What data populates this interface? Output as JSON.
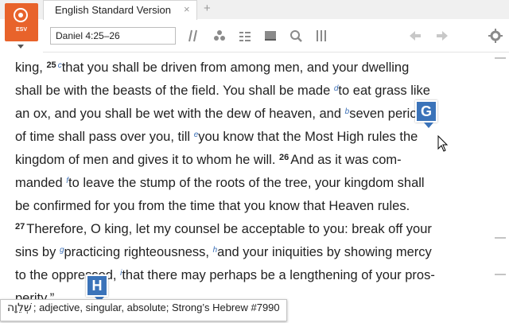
{
  "app": {
    "logo_label": "ESV",
    "tab_title": "English Standard Version",
    "tab_close": "×",
    "new_tab": "+"
  },
  "toolbar": {
    "reference_value": "Daniel 4:25–26",
    "icons": [
      "parallel-icon",
      "cluster-icon",
      "outline-icon",
      "layout-icon",
      "search-icon",
      "columns-icon",
      "back-arrow-icon",
      "forward-arrow-icon",
      "gear-icon"
    ]
  },
  "text_lines": [
    {
      "parts": [
        {
          "t": "king, "
        },
        {
          "v": "25"
        },
        {
          "f": "c"
        },
        {
          "t": "that you shall be driven from among men, and your dwelling"
        }
      ]
    },
    {
      "parts": [
        {
          "t": "shall be with the beasts of the field. You shall be made "
        },
        {
          "f": "d"
        },
        {
          "t": "to eat grass like"
        }
      ]
    },
    {
      "parts": [
        {
          "t": "an ox, and you shall be wet with the dew of heaven, and "
        },
        {
          "f": "b"
        },
        {
          "t": "seven periods"
        }
      ]
    },
    {
      "parts": [
        {
          "t": "of time shall pass over you, till "
        },
        {
          "f": "e"
        },
        {
          "t": "you know that the Most High rules the"
        }
      ]
    },
    {
      "parts": [
        {
          "t": "kingdom of men and gives it to whom he will. "
        },
        {
          "v": "26"
        },
        {
          "t": "And as it was com-"
        }
      ]
    },
    {
      "parts": [
        {
          "t": "manded "
        },
        {
          "f": "f"
        },
        {
          "t": "to leave the stump of the roots of the tree, your kingdom shall"
        }
      ]
    },
    {
      "parts": [
        {
          "t": "be confirmed for you from the time that you know that Heaven rules."
        }
      ]
    },
    {
      "parts": [
        {
          "v": "27"
        },
        {
          "t": "Therefore, O king, let my counsel be acceptable to you: break off your"
        }
      ]
    },
    {
      "parts": [
        {
          "t": "sins by "
        },
        {
          "f": "g"
        },
        {
          "t": "practicing righteousness, "
        },
        {
          "f": "h"
        },
        {
          "t": "and your iniquities by showing mercy"
        }
      ]
    },
    {
      "parts": [
        {
          "t": "to the oppressed, "
        },
        {
          "f": "i"
        },
        {
          "t": "that there may perhaps be a lengthening of your pros-"
        }
      ]
    },
    {
      "parts": [
        {
          "t": "perity.”"
        }
      ]
    }
  ],
  "badges": {
    "g_label": "G",
    "h_label": "H"
  },
  "tooltip": {
    "hebrew": "שְׁלֵוָה",
    "description": "; adjective, singular, absolute; Strong’s Hebrew #7990"
  },
  "colors": {
    "logo": "#e8632b",
    "footnote": "#3b6fb6",
    "badge": "#3b73b9"
  }
}
